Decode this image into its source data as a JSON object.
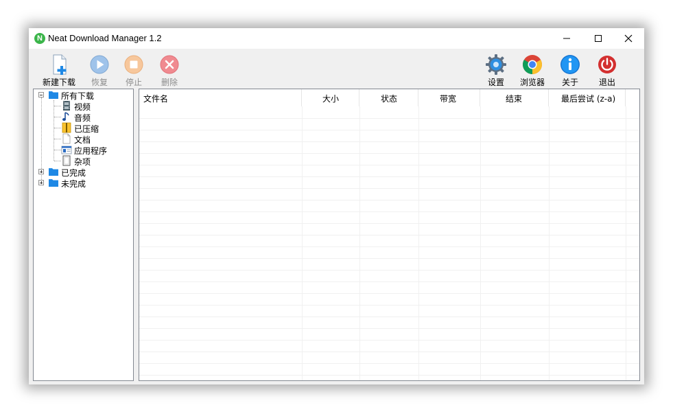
{
  "window": {
    "title": "Neat Download Manager 1.2",
    "app_icon_letter": "N"
  },
  "toolbar": {
    "left": [
      {
        "id": "new-download",
        "label": "新建下载",
        "icon": "new-download-icon",
        "enabled": true
      },
      {
        "id": "resume",
        "label": "恢复",
        "icon": "play-icon",
        "enabled": false
      },
      {
        "id": "stop",
        "label": "停止",
        "icon": "stop-icon",
        "enabled": false
      },
      {
        "id": "delete",
        "label": "删除",
        "icon": "delete-icon",
        "enabled": false
      }
    ],
    "right": [
      {
        "id": "settings",
        "label": "设置",
        "icon": "gear-icon"
      },
      {
        "id": "browser",
        "label": "浏览器",
        "icon": "chrome-icon"
      },
      {
        "id": "about",
        "label": "关于",
        "icon": "info-icon"
      },
      {
        "id": "exit",
        "label": "退出",
        "icon": "power-icon"
      }
    ]
  },
  "tree": {
    "root": {
      "label": "所有下载",
      "expanded": true
    },
    "children": [
      {
        "label": "视频",
        "icon": "video-icon"
      },
      {
        "label": "音频",
        "icon": "music-icon"
      },
      {
        "label": "已压缩",
        "icon": "archive-icon"
      },
      {
        "label": "文档",
        "icon": "document-icon"
      },
      {
        "label": "应用程序",
        "icon": "application-icon"
      },
      {
        "label": "杂项",
        "icon": "misc-icon"
      }
    ],
    "others": [
      {
        "label": "已完成",
        "expanded": false
      },
      {
        "label": "未完成",
        "expanded": false
      }
    ]
  },
  "list": {
    "columns": [
      "文件名",
      "大小",
      "状态",
      "带宽",
      "结束",
      "最后尝试 (z-a)"
    ],
    "rows": []
  },
  "colors": {
    "accent_blue": "#1e88e5",
    "disabled_gray": "#8c8c8c",
    "delete_red": "#e8747a",
    "exit_red": "#d32f2f"
  }
}
